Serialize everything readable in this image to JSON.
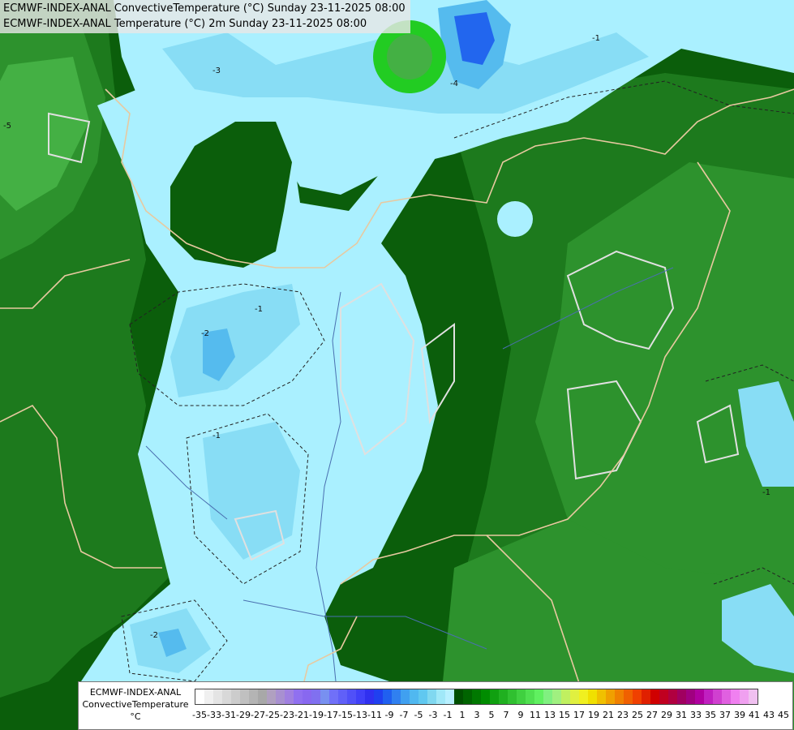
{
  "title": {
    "line1": "ECMWF-INDEX-ANAL ConvectiveTemperature (°C) Sunday 23-11-2025 08:00",
    "line2": "ECMWF-INDEX-ANAL Temperature (°C) 2m Sunday 23-11-2025 08:00"
  },
  "legend": {
    "label_line1": "ECMWF-INDEX-ANAL",
    "label_line2": "ConvectiveTemperature",
    "label_line3": "°C",
    "ticks": [
      "-35",
      "-33",
      "-31",
      "-29",
      "-27",
      "-25",
      "-23",
      "-21",
      "-19",
      "-17",
      "-15",
      "-13",
      "-11",
      "-9",
      "-7",
      "-5",
      "-3",
      "-1",
      "1",
      "3",
      "5",
      "7",
      "9",
      "11",
      "13",
      "15",
      "17",
      "19",
      "21",
      "23",
      "25",
      "27",
      "29",
      "31",
      "33",
      "35",
      "37",
      "39",
      "41",
      "43",
      "45"
    ],
    "colors": [
      "#ffffff",
      "#f0f0f0",
      "#e0e0e0",
      "#d0d0d0",
      "#c0c0c0",
      "#b0b0b0",
      "#a8a0b8",
      "#a090c8",
      "#9a80d8",
      "#9070e0",
      "#8060e8",
      "#7070f0",
      "#6080f0",
      "#5090f0",
      "#40a0f0",
      "#40b0f0",
      "#50c0f0",
      "#70d0f0",
      "#90e0f0",
      "#b0f0ff",
      "#005000",
      "#006000",
      "#007000",
      "#008000",
      "#109010",
      "#20a020",
      "#30b030",
      "#40c040",
      "#50d050",
      "#60e060",
      "#80f080",
      "#a0f0a0",
      "#c0f0c0",
      "#d0f0a0",
      "#e0f080",
      "#f0f060",
      "#f0e040",
      "#f0c030",
      "#f0a020",
      "#f08010",
      "#f06000",
      "#f04000",
      "#e02020",
      "#d01010",
      "#c00000",
      "#b00000",
      "#a00020",
      "#a00050",
      "#a00080",
      "#b000b0",
      "#c020c0",
      "#d040d0",
      "#e060e0",
      "#f080f0",
      "#f0a0f0",
      "#f0c0f0",
      "#ffe0ff",
      "#ffffff",
      "#ffffff",
      "#ffffff",
      "#ffffff",
      "#ffffff",
      "#ffffff",
      "#ffffff",
      "#ffffff",
      "#ffffff",
      "#ffffff",
      "#ffffff",
      "#ffffff",
      "#ffffff",
      "#ffffff"
    ]
  },
  "colors": {
    "dark_green": "#0b5e0b",
    "mid_green": "#1d7a1d",
    "green": "#2d922d",
    "light_green": "#44b044",
    "bright_green": "#22cc22",
    "pale_cyan": "#aaf0ff",
    "light_blue": "#88ddf5",
    "blue": "#55bbee",
    "deep_blue": "#2266ee",
    "border": "#e8c9a0",
    "contour_white": "#e0e0e0"
  }
}
